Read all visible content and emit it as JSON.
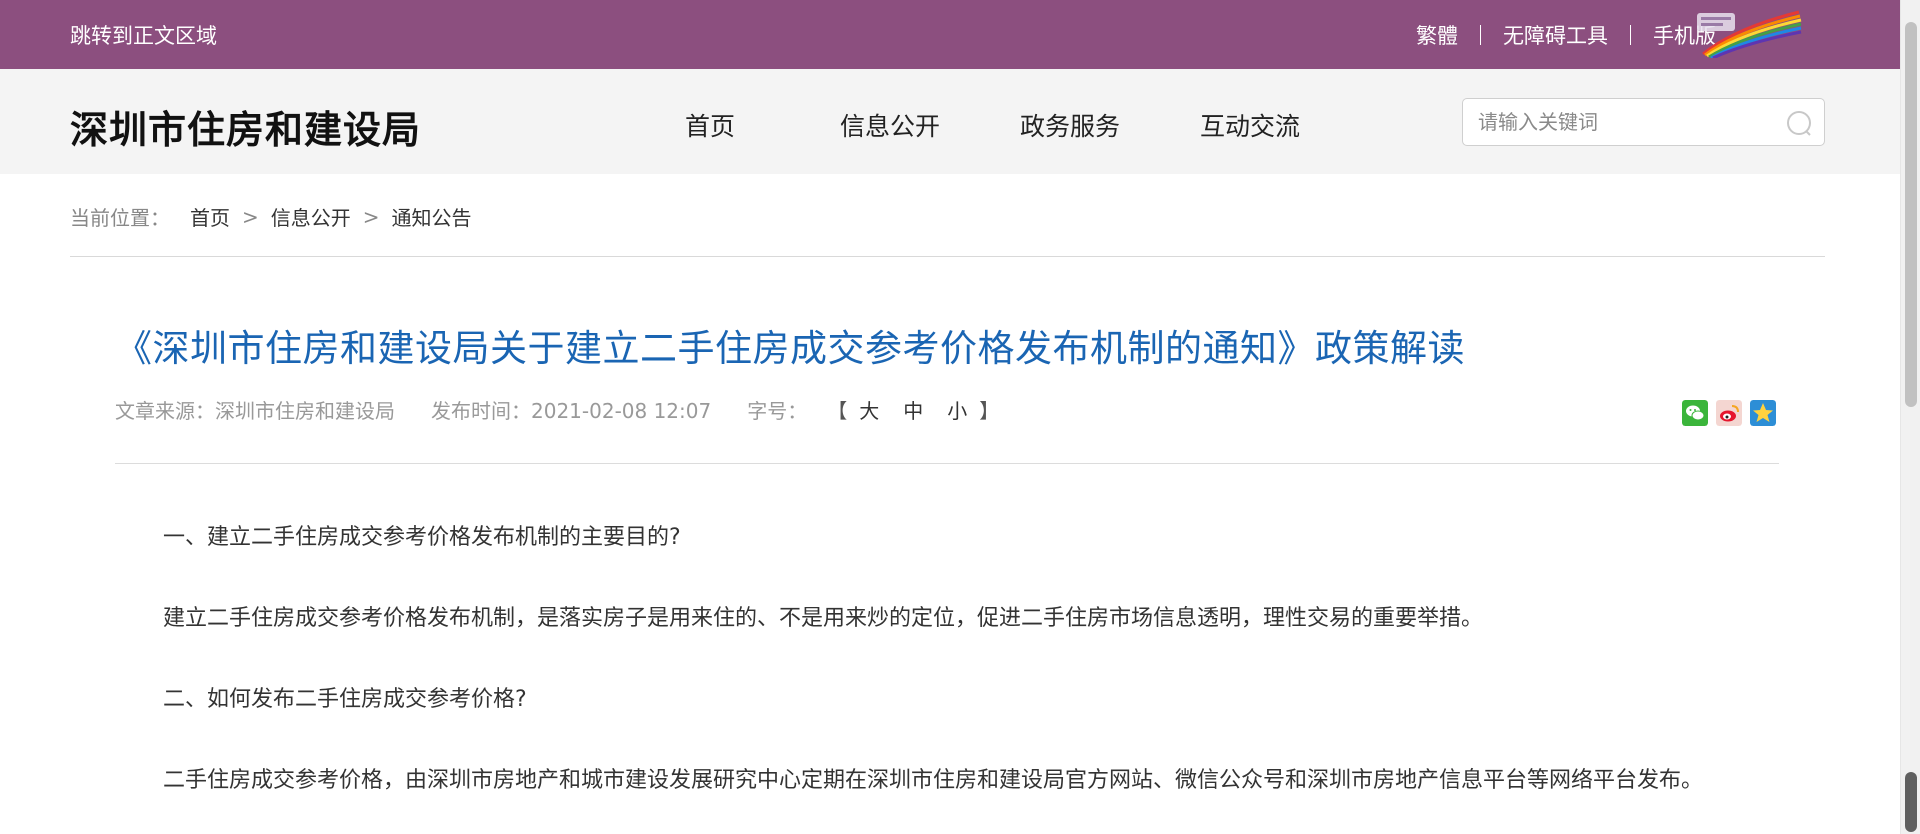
{
  "topbar": {
    "skip_link": "跳转到正文区域",
    "links": [
      "繁體",
      "无障碍工具",
      "手机版"
    ],
    "accent_color": "#8c4f7f"
  },
  "header": {
    "site_title": "深圳市住房和建设局",
    "nav": [
      "首页",
      "信息公开",
      "政务服务",
      "互动交流"
    ],
    "search_placeholder": "请输入关键词"
  },
  "breadcrumb": {
    "label": "当前位置：",
    "items": [
      "首页",
      "信息公开",
      "通知公告"
    ],
    "separator": ">"
  },
  "article": {
    "title": "《深圳市住房和建设局关于建立二手住房成交参考价格发布机制的通知》政策解读",
    "source": "文章来源：深圳市住房和建设局",
    "published": "发布时间：2021-02-08 12:07",
    "font_size_label": "字号：",
    "font_size_open": "【",
    "font_size_close": "】",
    "font_sizes": [
      "大",
      "中",
      "小"
    ],
    "share_icons": [
      "wechat-icon",
      "weibo-icon",
      "qzone-icon"
    ],
    "title_color": "#1a65b3",
    "paragraphs": [
      "一、建立二手住房成交参考价格发布机制的主要目的?",
      "建立二手住房成交参考价格发布机制，是落实房子是用来住的、不是用来炒的定位，促进二手住房市场信息透明，理性交易的重要举措。",
      "二、如何发布二手住房成交参考价格?",
      "二手住房成交参考价格，由深圳市房地产和城市建设发展研究中心定期在深圳市住房和建设局官方网站、微信公众号和深圳市房地产信息平台等网络平台发布。"
    ]
  }
}
